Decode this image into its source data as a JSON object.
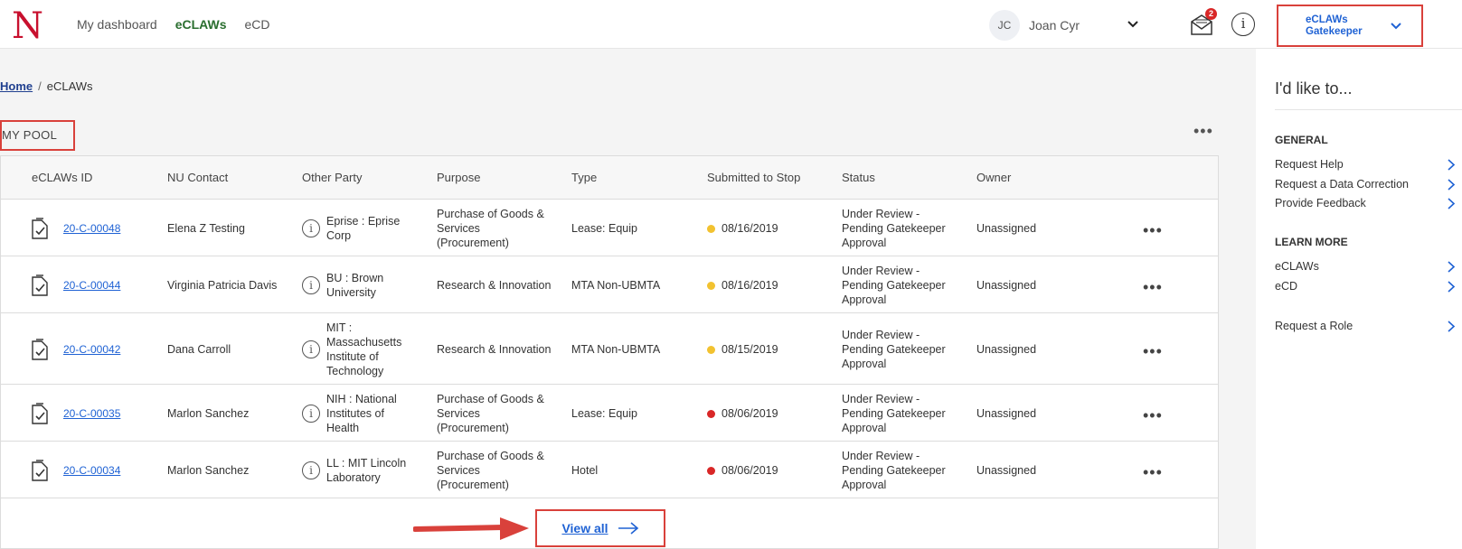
{
  "header": {
    "logo_letter": "N",
    "nav": [
      "My dashboard",
      "eCLAWs",
      "eCD"
    ],
    "active_nav": "eCLAWs",
    "user": {
      "initials": "JC",
      "name": "Joan Cyr"
    },
    "mail_badge": "2",
    "info_symbol": "i",
    "role": "eCLAWs Gatekeeper"
  },
  "breadcrumb": {
    "home": "Home",
    "separator": "/",
    "current": "eCLAWs"
  },
  "pool": {
    "title": "MY POOL",
    "more_label": "•••",
    "columns": [
      "eCLAWs ID",
      "NU Contact",
      "Other Party",
      "Purpose",
      "Type",
      "Submitted to Stop",
      "Status",
      "Owner"
    ],
    "rows": [
      {
        "id": "20-C-00048",
        "contact": "Elena Z Testing",
        "party": "Eprise : Eprise Corp",
        "purpose": "Purchase of Goods & Services (Procurement)",
        "type": "Lease: Equip",
        "date": "08/16/2019",
        "status_color": "#f2c230",
        "status": "Under Review - Pending Gatekeeper Approval",
        "owner": "Unassigned"
      },
      {
        "id": "20-C-00044",
        "contact": "Virginia Patricia Davis",
        "party": "BU : Brown University",
        "purpose": "Research & Innovation",
        "type": "MTA Non-UBMTA",
        "date": "08/16/2019",
        "status_color": "#f2c230",
        "status": "Under Review - Pending Gatekeeper Approval",
        "owner": "Unassigned"
      },
      {
        "id": "20-C-00042",
        "contact": "Dana Carroll",
        "party": "MIT : Massachusetts Institute of Technology",
        "purpose": "Research & Innovation",
        "type": "MTA Non-UBMTA",
        "date": "08/15/2019",
        "status_color": "#f2c230",
        "status": "Under Review - Pending Gatekeeper Approval",
        "owner": "Unassigned"
      },
      {
        "id": "20-C-00035",
        "contact": "Marlon Sanchez",
        "party": "NIH : National Institutes of Health",
        "purpose": "Purchase of Goods & Services (Procurement)",
        "type": "Lease: Equip",
        "date": "08/06/2019",
        "status_color": "#d92727",
        "status": "Under Review - Pending Gatekeeper Approval",
        "owner": "Unassigned"
      },
      {
        "id": "20-C-00034",
        "contact": "Marlon Sanchez",
        "party": "LL : MIT Lincoln Laboratory",
        "purpose": "Purchase of Goods & Services (Procurement)",
        "type": "Hotel",
        "date": "08/06/2019",
        "status_color": "#d92727",
        "status": "Under Review - Pending Gatekeeper Approval",
        "owner": "Unassigned"
      }
    ],
    "view_all": "View all"
  },
  "panel": {
    "title": "I'd like to...",
    "sections": [
      {
        "heading": "GENERAL",
        "items": [
          "Request Help",
          "Request a Data Correction",
          "Provide Feedback"
        ]
      },
      {
        "heading": "LEARN MORE",
        "items": [
          "eCLAWs",
          "eCD"
        ]
      },
      {
        "heading": "",
        "items": [
          "Request a Role"
        ]
      }
    ]
  },
  "colors": {
    "accent": "#1f62d4",
    "brand_red": "#c8102e",
    "highlight": "#d9413b",
    "active_nav": "#2a6e2f"
  }
}
